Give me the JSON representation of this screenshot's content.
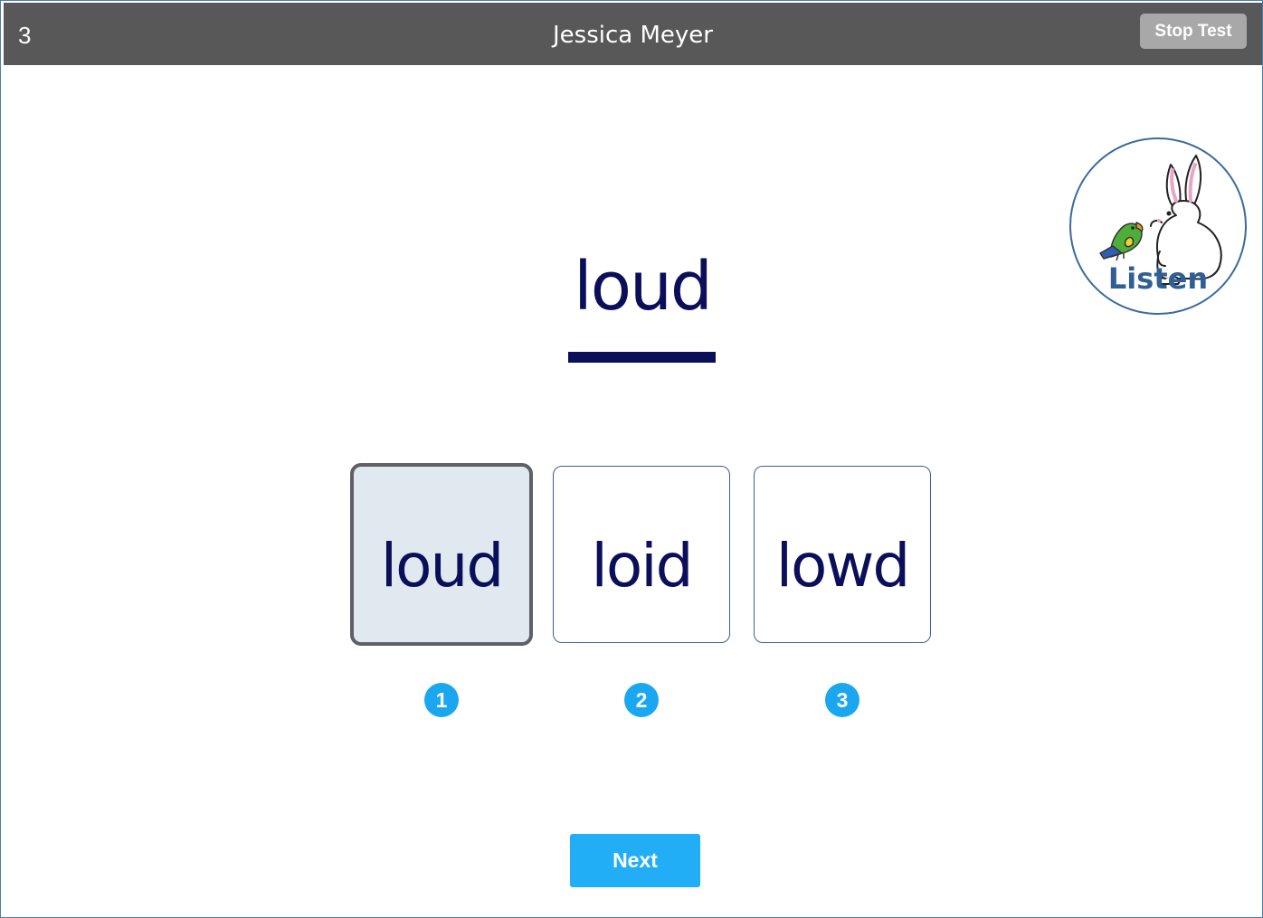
{
  "header": {
    "item_number": "3",
    "student_name": "Jessica Meyer",
    "stop_label": "Stop Test"
  },
  "listen": {
    "label": "Listen",
    "icon": "rabbit-and-parrot-icon"
  },
  "prompt": {
    "word": "loud"
  },
  "choices": [
    {
      "word": "loud",
      "number": "1",
      "selected": true
    },
    {
      "word": "loid",
      "number": "2",
      "selected": false
    },
    {
      "word": "lowd",
      "number": "3",
      "selected": false
    }
  ],
  "footer": {
    "next_label": "Next"
  },
  "colors": {
    "header_bg": "#585858",
    "word_color": "#0b0f5a",
    "badge_blue": "#1aa7ef",
    "next_blue": "#22adf7",
    "selected_bg": "#e0e8f0",
    "listen_text": "#2f5f95"
  }
}
